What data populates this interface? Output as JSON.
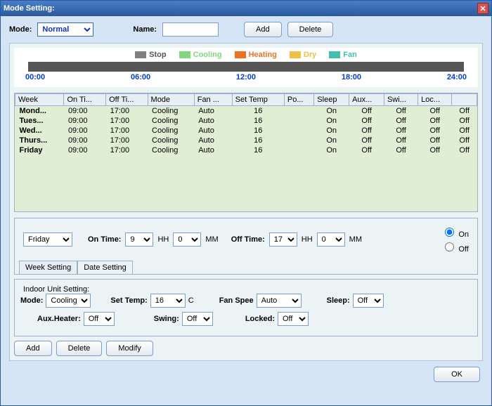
{
  "title": "Mode Setting:",
  "labels": {
    "mode": "Mode:",
    "name": "Name:",
    "add": "Add",
    "delete": "Delete",
    "modify": "Modify",
    "ok": "OK",
    "onTime": "On Time:",
    "offTime": "Off Time:",
    "hh": "HH",
    "mm": "MM",
    "weekSetting": "Week Setting",
    "dateSetting": "Date Setting",
    "indoorUnit": "Indoor Unit Setting:",
    "setTemp": "Set Temp:",
    "c": "C",
    "fanSpeed": "Fan Spee",
    "sleep": "Sleep:",
    "auxHeater": "Aux.Heater:",
    "swing": "Swing:",
    "locked": "Locked:",
    "on": "On",
    "off": "Off"
  },
  "modeSelect": "Normal",
  "nameValue": "",
  "legend": [
    {
      "label": "Stop",
      "color": "#808080"
    },
    {
      "label": "Cooling",
      "color": "#7fd87f"
    },
    {
      "label": "Heating",
      "color": "#f07020"
    },
    {
      "label": "Dry",
      "color": "#f0c040"
    },
    {
      "label": "Fan",
      "color": "#40c0b0"
    }
  ],
  "timeLabels": [
    "00:00",
    "06:00",
    "12:00",
    "18:00",
    "24:00"
  ],
  "columns": [
    "Week",
    "On Ti...",
    "Off Ti...",
    "Mode",
    "Fan ...",
    "Set Temp",
    "Po...",
    "Sleep",
    "Aux...",
    "Swi...",
    "Loc..."
  ],
  "rows": [
    {
      "week": "Mond...",
      "on": "09:00",
      "off": "17:00",
      "mode": "Cooling",
      "fan": "Auto",
      "temp": "16",
      "po": "",
      "sleep": "On",
      "aux": "Off",
      "swing": "Off",
      "lock": "Off",
      "extra": "Off"
    },
    {
      "week": "Tues...",
      "on": "09:00",
      "off": "17:00",
      "mode": "Cooling",
      "fan": "Auto",
      "temp": "16",
      "po": "",
      "sleep": "On",
      "aux": "Off",
      "swing": "Off",
      "lock": "Off",
      "extra": "Off"
    },
    {
      "week": "Wed...",
      "on": "09:00",
      "off": "17:00",
      "mode": "Cooling",
      "fan": "Auto",
      "temp": "16",
      "po": "",
      "sleep": "On",
      "aux": "Off",
      "swing": "Off",
      "lock": "Off",
      "extra": "Off"
    },
    {
      "week": "Thurs...",
      "on": "09:00",
      "off": "17:00",
      "mode": "Cooling",
      "fan": "Auto",
      "temp": "16",
      "po": "",
      "sleep": "On",
      "aux": "Off",
      "swing": "Off",
      "lock": "Off",
      "extra": "Off"
    },
    {
      "week": "Friday",
      "on": "09:00",
      "off": "17:00",
      "mode": "Cooling",
      "fan": "Auto",
      "temp": "16",
      "po": "",
      "sleep": "On",
      "aux": "Off",
      "swing": "Off",
      "lock": "Off",
      "extra": "Off"
    }
  ],
  "daySelect": "Friday",
  "onHH": "9",
  "onMM": "0",
  "offHH": "17",
  "offMM": "0",
  "indoor": {
    "mode": "Cooling",
    "setTemp": "16",
    "fanSpeed": "Auto",
    "sleep": "Off",
    "aux": "Off",
    "swing": "Off",
    "locked": "Off"
  }
}
